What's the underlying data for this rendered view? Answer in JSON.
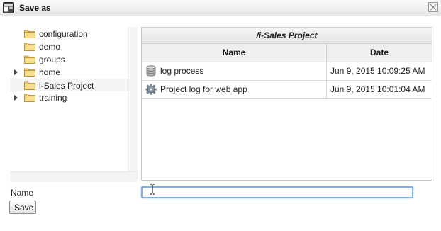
{
  "dialog": {
    "title": "Save as"
  },
  "tree": {
    "items": [
      {
        "label": "configuration",
        "expandable": false,
        "selected": false
      },
      {
        "label": "demo",
        "expandable": false,
        "selected": false
      },
      {
        "label": "groups",
        "expandable": false,
        "selected": false
      },
      {
        "label": "home",
        "expandable": true,
        "selected": false
      },
      {
        "label": "i-Sales Project",
        "expandable": false,
        "selected": true
      },
      {
        "label": "training",
        "expandable": true,
        "selected": false
      }
    ]
  },
  "file_list": {
    "path": "/i-Sales Project",
    "columns": {
      "name": "Name",
      "date": "Date"
    },
    "rows": [
      {
        "name": "log process",
        "date": "Jun 9, 2015 10:09:25 AM",
        "icon": "database-icon"
      },
      {
        "name": "Project log for web app",
        "date": "Jun 9, 2015 10:01:04 AM",
        "icon": "gear-icon"
      }
    ]
  },
  "form": {
    "name_label": "Name",
    "name_value": "",
    "save_label": "Save"
  }
}
